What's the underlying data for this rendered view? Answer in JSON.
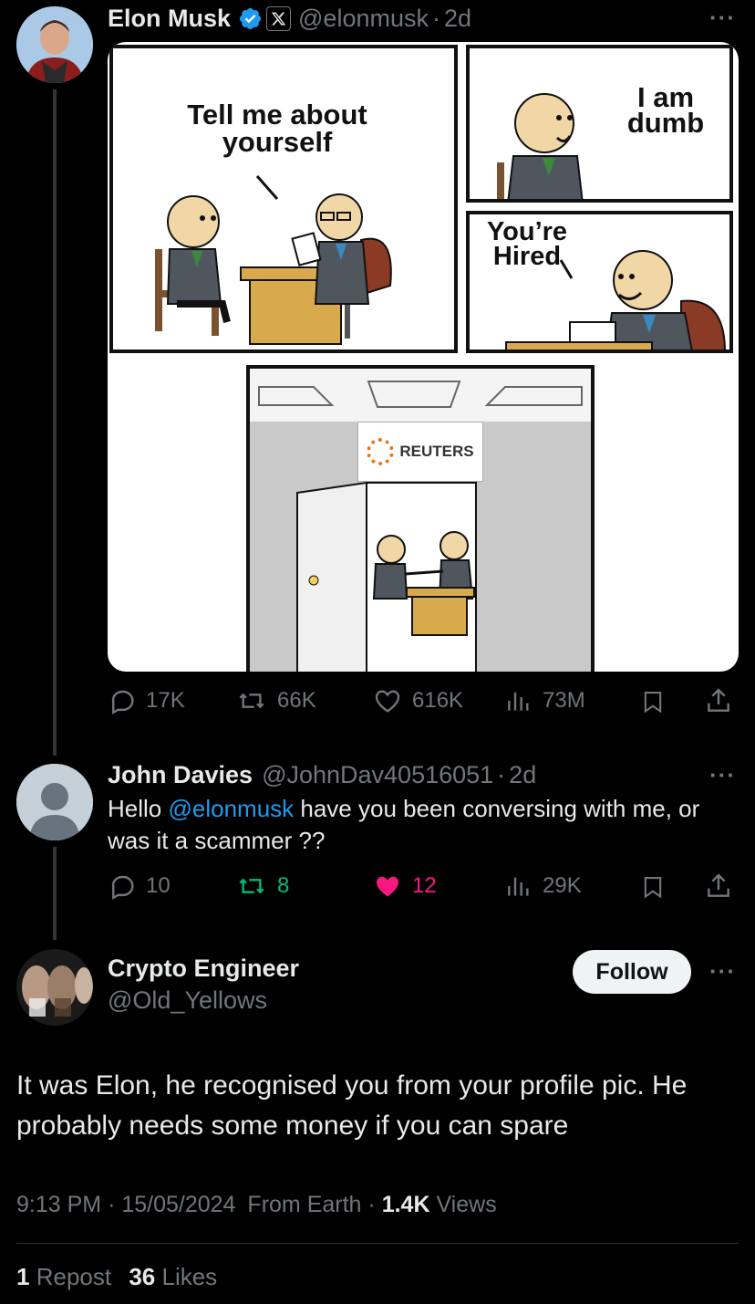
{
  "tweet1": {
    "name": "Elon Musk",
    "handle": "@elonmusk",
    "time": "2d",
    "comic": {
      "panel1_text": "Tell me about yourself",
      "panel2_text": "I am dumb",
      "panel3_text": "You’re Hired",
      "sign_text": "REUTERS"
    },
    "replies": "17K",
    "reposts": "66K",
    "likes": "616K",
    "views": "73M"
  },
  "tweet2": {
    "name": "John Davies",
    "handle": "@JohnDav40516051",
    "time": "2d",
    "text_before": "Hello ",
    "mention": "@elonmusk",
    "text_after": " have you been conversing with me, or was it a scammer ??",
    "replies": "10",
    "reposts": "8",
    "likes": "12",
    "views": "29K"
  },
  "tweet3": {
    "name": "Crypto Engineer",
    "handle": "@Old_Yellows",
    "follow_label": "Follow",
    "text": "It was Elon, he recognised you from your profile pic. He probably needs some money if you can spare",
    "time": "9:13 PM",
    "date": "15/05/2024",
    "source": "From Earth",
    "views_count": "1.4K",
    "views_label": "Views",
    "reposts_count": "1",
    "reposts_label": "Repost",
    "likes_count": "36",
    "likes_label": "Likes"
  },
  "colors": {
    "accent": "#1d9bf0",
    "like_active": "#f91880",
    "muted": "#71767b",
    "repost_active": "#00ba7c"
  }
}
